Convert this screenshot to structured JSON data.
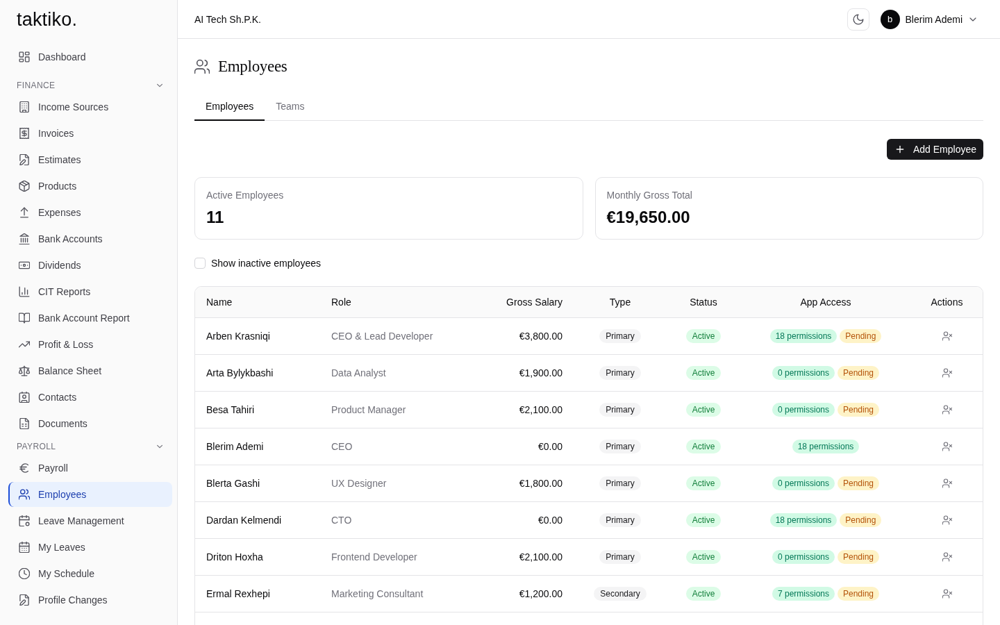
{
  "sidebar": {
    "logo": "taktiko.",
    "sections": [
      {
        "items": [
          {
            "label": "Dashboard",
            "selected": false
          }
        ]
      },
      {
        "title": "FINANCE",
        "expanded": true,
        "items": [
          {
            "label": "Income Sources",
            "selected": false
          },
          {
            "label": "Invoices",
            "selected": false
          },
          {
            "label": "Estimates",
            "selected": false
          },
          {
            "label": "Products",
            "selected": false
          },
          {
            "label": "Expenses",
            "selected": false
          },
          {
            "label": "Bank Accounts",
            "selected": false
          },
          {
            "label": "Dividends",
            "selected": false
          },
          {
            "label": "CIT Reports",
            "selected": false
          },
          {
            "label": "Bank Account Report",
            "selected": false
          },
          {
            "label": "Profit & Loss",
            "selected": false
          },
          {
            "label": "Balance Sheet",
            "selected": false
          },
          {
            "label": "Contacts",
            "selected": false
          },
          {
            "label": "Documents",
            "selected": false
          }
        ]
      },
      {
        "title": "PAYROLL",
        "expanded": true,
        "items": [
          {
            "label": "Payroll",
            "selected": false
          },
          {
            "label": "Employees",
            "selected": true
          },
          {
            "label": "Leave Management",
            "selected": false
          },
          {
            "label": "My Leaves",
            "selected": false
          },
          {
            "label": "My Schedule",
            "selected": false
          },
          {
            "label": "Profile Changes",
            "selected": false
          }
        ]
      }
    ]
  },
  "header": {
    "company": "AI Tech Sh.P.K.",
    "user": {
      "initial": "b",
      "name": "Blerim Ademi"
    }
  },
  "page": {
    "title": "Employees"
  },
  "tabs": [
    {
      "label": "Employees",
      "selected": true
    },
    {
      "label": "Teams",
      "selected": false
    }
  ],
  "add_button": "Add Employee",
  "stats": [
    {
      "label": "Active Employees",
      "value": "11"
    },
    {
      "label": "Monthly Gross Total",
      "value": "€19,650.00"
    }
  ],
  "show_inactive": {
    "label": "Show inactive employees",
    "checked": false
  },
  "table": {
    "columns": [
      "Name",
      "Role",
      "Gross Salary",
      "Type",
      "Status",
      "App Access",
      "Actions"
    ],
    "rows": [
      {
        "name": "Arben Krasniqi",
        "role": "CEO & Lead Developer",
        "salary": "€3,800.00",
        "type": "Primary",
        "status": "Active",
        "permissions": "18 permissions",
        "access_state": "Pending"
      },
      {
        "name": "Arta Bylykbashi",
        "role": "Data Analyst",
        "salary": "€1,900.00",
        "type": "Primary",
        "status": "Active",
        "permissions": "0 permissions",
        "access_state": "Pending"
      },
      {
        "name": "Besa Tahiri",
        "role": "Product Manager",
        "salary": "€2,100.00",
        "type": "Primary",
        "status": "Active",
        "permissions": "0 permissions",
        "access_state": "Pending"
      },
      {
        "name": "Blerim Ademi",
        "role": "CEO",
        "salary": "€0.00",
        "type": "Primary",
        "status": "Active",
        "permissions": "18 permissions"
      },
      {
        "name": "Blerta Gashi",
        "role": "UX Designer",
        "salary": "€1,800.00",
        "type": "Primary",
        "status": "Active",
        "permissions": "0 permissions",
        "access_state": "Pending"
      },
      {
        "name": "Dardan Kelmendi",
        "role": "CTO",
        "salary": "€0.00",
        "type": "Primary",
        "status": "Active",
        "permissions": "18 permissions",
        "access_state": "Pending"
      },
      {
        "name": "Driton Hoxha",
        "role": "Frontend Developer",
        "salary": "€2,100.00",
        "type": "Primary",
        "status": "Active",
        "permissions": "0 permissions",
        "access_state": "Pending"
      },
      {
        "name": "Ermal Rexhepi",
        "role": "Marketing Consultant",
        "salary": "€1,200.00",
        "type": "Secondary",
        "status": "Active",
        "permissions": "7 permissions",
        "access_state": "Pending"
      }
    ]
  }
}
